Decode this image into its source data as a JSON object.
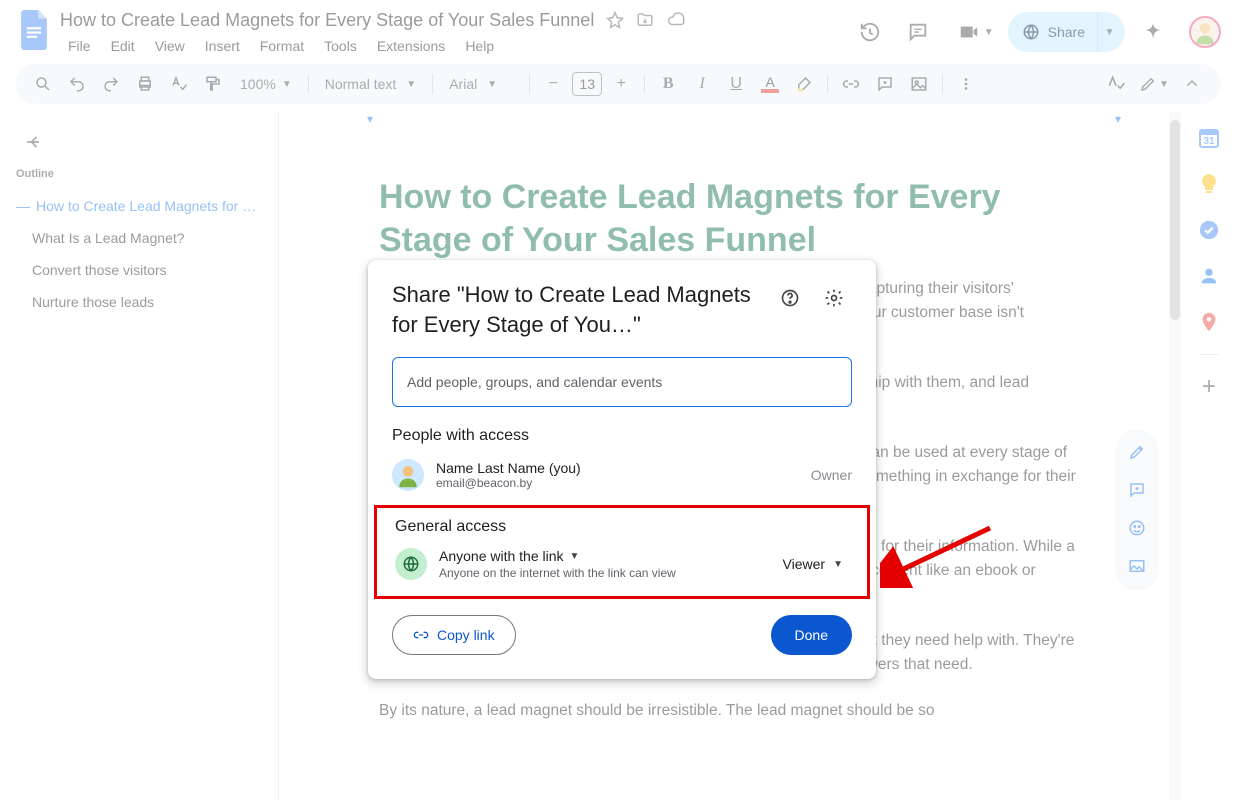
{
  "header": {
    "doc_title": "How to Create Lead Magnets for Every Stage of Your Sales Funnel",
    "menu": [
      "File",
      "Edit",
      "View",
      "Insert",
      "Format",
      "Tools",
      "Extensions",
      "Help"
    ],
    "share_label": "Share"
  },
  "toolbar": {
    "zoom": "100%",
    "style": "Normal text",
    "font": "Arial",
    "font_size": "13",
    "text_color_letter": "A",
    "highlight_color": "#fdd835",
    "underline_color": "#d93025"
  },
  "outline": {
    "header": "Outline",
    "top_item": "How to Create Lead Magnets for …",
    "items": [
      "What Is a Lead Magnet?",
      "Convert those visitors",
      "Nurture those leads"
    ]
  },
  "document": {
    "h1": "How to Create Lead Magnets for Every Stage of Your Sales Funnel",
    "p1": "Today's most successful digital marketers have moved beyond simply capturing their visitors' attention. They've learned that providing value in the hope of growing your customer base isn't enough anymore.",
    "p2": "Now, to land sustainable customers, it's vital to first establish a relationship with them, and lead magnets help you do just that.",
    "p3": "While lead magnets may seem rudimentary, this simple marketing tool can be used at every stage of your sales funnel. Instead of only offering your prospective customers something in exchange for their contact information, you can leverage this freebie deep into your funnel.",
    "p4": "A lead magnet is free and valuable content you offer visitors in exchange for their information. While a lead magnet can be many different things, it's most often downloadable content like an ebook or whitepaper.",
    "p5": "This works out perfectly because your average visitor has a problem that they need help with. They're on your site looking for solutions to that problem. Your lead magnet answers that need.",
    "p6": "By its nature, a lead magnet should be irresistible. The lead magnet should be so"
  },
  "side_panel": {
    "icons": [
      "calendar",
      "keep",
      "tasks",
      "contacts",
      "maps"
    ],
    "calendar_day": "31"
  },
  "dialog": {
    "title_prefix": "Share \"",
    "title_doc": "How to Create Lead Magnets for Every Stage of You…",
    "title_suffix": "\"",
    "input_placeholder": "Add people, groups, and calendar events",
    "people_heading": "People with access",
    "person": {
      "name": "Name Last Name (you)",
      "email": "email@beacon.by",
      "role": "Owner"
    },
    "general_heading": "General access",
    "ga_title": "Anyone with the link",
    "ga_desc": "Anyone on the internet with the link can view",
    "ga_role": "Viewer",
    "copy_link": "Copy link",
    "done": "Done"
  }
}
